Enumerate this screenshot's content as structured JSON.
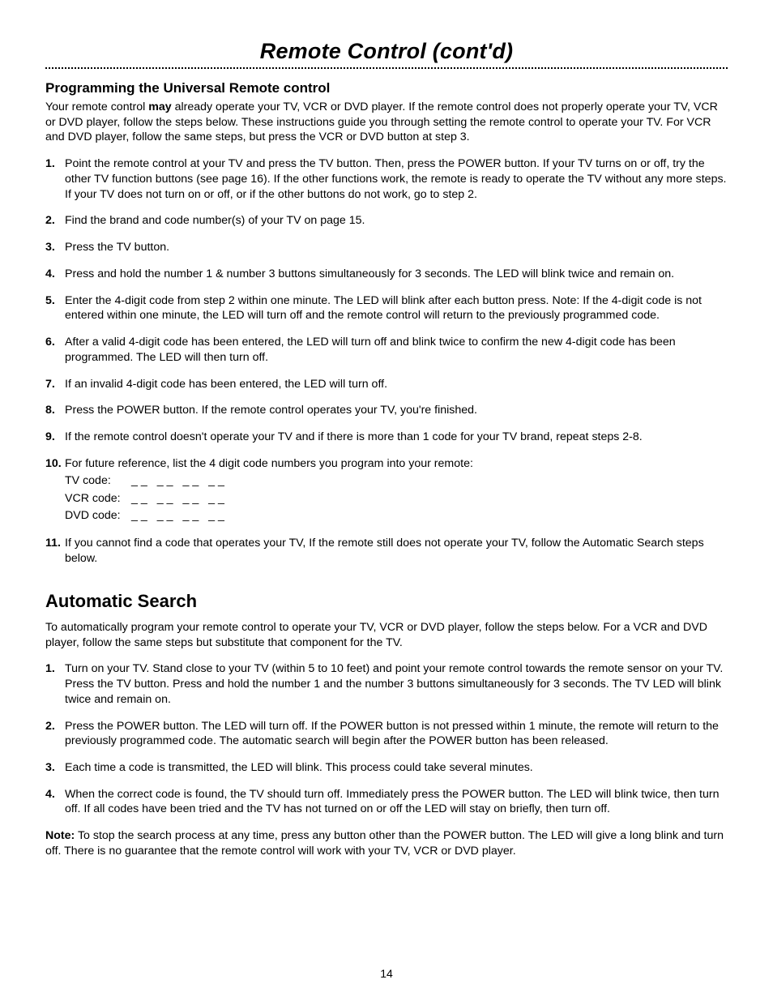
{
  "page_number": "14",
  "title": "Remote Control (cont'd)",
  "section1": {
    "heading": "Programming the Universal Remote control",
    "intro_pre": "Your remote control ",
    "intro_may": "may",
    "intro_post": " already operate your TV, VCR or DVD player. If the remote control does not properly operate your TV, VCR or DVD player, follow the steps below. These instructions guide you through setting the remote control to operate your TV. For VCR and DVD player, follow the same steps, but press the VCR or DVD button at step 3.",
    "steps": [
      "Point the remote control at your TV and press the TV button. Then, press the POWER button. If your TV turns on or off, try the other TV function buttons (see page 16). If the other functions work, the remote is ready to operate the TV without any more steps. If your TV does not turn on or off, or if the other buttons do not work, go to step 2.",
      "Find the brand and code number(s) of your TV on page 15.",
      "Press the TV button.",
      "Press and hold the number 1 & number 3 buttons simultaneously for 3 seconds. The LED will blink twice and remain on.",
      "Enter the 4-digit code from step 2 within one minute. The LED will blink after each button press. Note: If the 4-digit code is not entered within one minute, the LED will turn off and the remote control will return to the previously programmed code.",
      "After a valid 4-digit code has been entered, the LED will turn off and blink twice to confirm the new 4-digit code has been programmed. The LED will then turn off.",
      "If an invalid 4-digit code has been entered, the LED will turn off.",
      "Press the POWER button. If the remote control operates your TV, you're finished.",
      "If the remote control doesn't operate your TV and if there is more than 1 code for your TV brand, repeat steps 2-8."
    ],
    "step10_lead": "For future reference, list the 4 digit code numbers you program into your remote:",
    "codes": {
      "tv_label": "TV code:",
      "vcr_label": "VCR code:",
      "dvd_label": "DVD code:",
      "blanks": "__ __ __ __"
    },
    "step11": "If you cannot find a code that operates your TV, If the remote still does not operate your TV, follow the Automatic Search steps below."
  },
  "section2": {
    "heading": "Automatic Search",
    "intro": "To automatically program your remote control to operate your TV, VCR or DVD player, follow the steps below. For a VCR and DVD player, follow the same steps but substitute that component for the TV.",
    "steps": [
      "Turn on your TV. Stand close to your TV (within 5 to 10 feet) and point your remote control towards the remote sensor on your TV. Press the TV button. Press and hold the number 1 and the number 3 buttons simultaneously for 3 seconds. The TV LED will blink twice and remain on.",
      "Press the POWER button. The LED will turn off. If the POWER button is not pressed within 1 minute, the remote will return to the previously programmed code. The automatic search will begin after the POWER button has been released.",
      "Each time a code is transmitted, the LED will blink. This process could take several minutes.",
      "When the correct code is found, the TV should turn off. Immediately press the POWER button. The LED will blink twice, then turn off. If all codes have been tried and the TV has not turned on or off the LED will stay on briefly, then turn off."
    ],
    "note_label": "Note:",
    "note_body": " To stop the search process at any time, press any button other than the POWER button. The LED will give a long blink and turn off. There is no guarantee that the remote control will work with your TV, VCR or DVD player."
  }
}
